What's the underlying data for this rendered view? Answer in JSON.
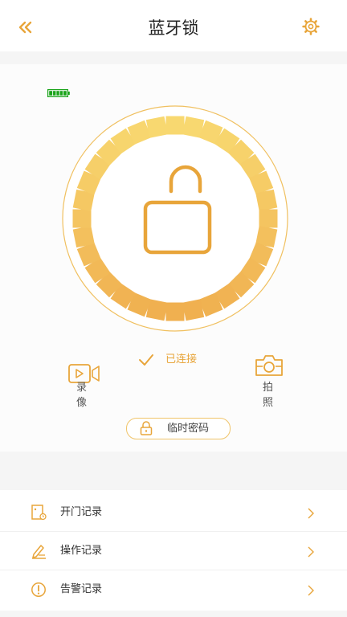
{
  "header": {
    "title": "蓝牙锁",
    "back_icon": "double-chevron-left-icon",
    "settings_icon": "gear-icon"
  },
  "lock": {
    "battery_level": 1.0,
    "state_icon": "unlocked-padlock-icon",
    "status_text": "已连接"
  },
  "actions": {
    "record_label": "录像",
    "photo_label": "拍照",
    "temp_password_label": "临时密码"
  },
  "menu": {
    "items": [
      {
        "label": "开门记录",
        "icon": "door-record-icon"
      },
      {
        "label": "操作记录",
        "icon": "edit-record-icon"
      },
      {
        "label": "告警记录",
        "icon": "alert-record-icon"
      }
    ]
  },
  "colors": {
    "accent": "#e8a53a",
    "ring_light": "#f8d870",
    "ring_dark": "#f0b050",
    "battery": "#1aa31a"
  }
}
